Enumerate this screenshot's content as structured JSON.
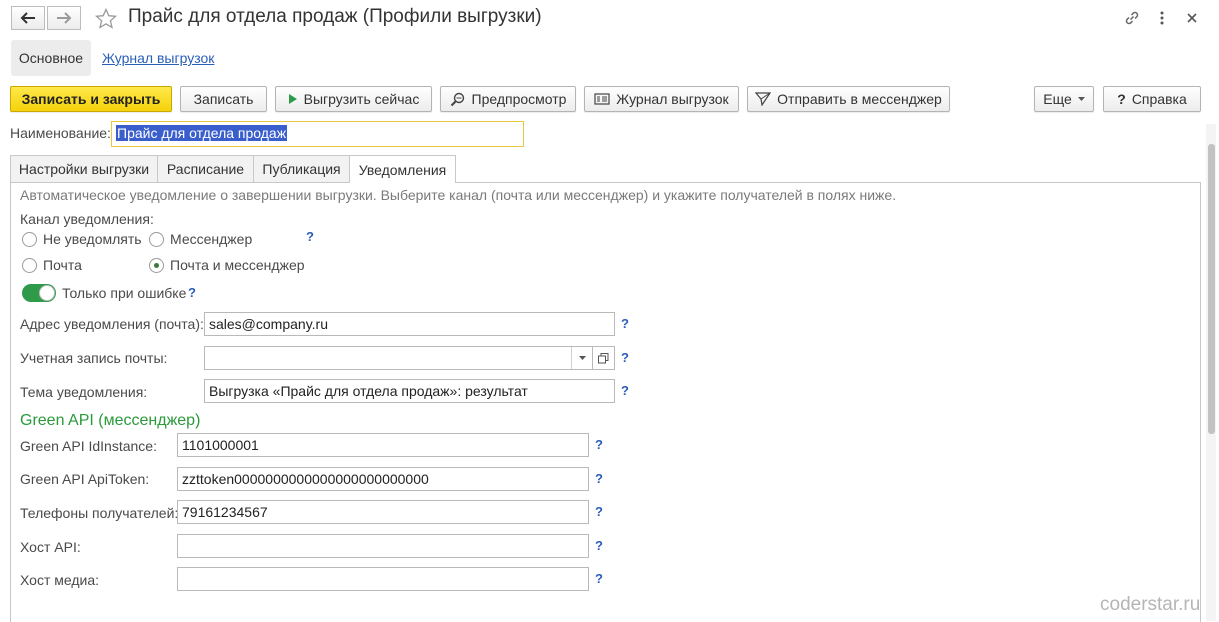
{
  "window": {
    "title": "Прайс для отдела продаж (Профили выгрузки)",
    "back_icon": "arrow-left-icon",
    "forward_icon": "arrow-right-icon",
    "favorite_icon": "star-icon",
    "link_icon": "link-icon",
    "more_icon": "more-vertical-icon",
    "close_icon": "close-icon"
  },
  "view_tabs": {
    "main": "Основное",
    "journal": "Журнал выгрузок"
  },
  "toolbar": {
    "save_close": "Записать и закрыть",
    "save": "Записать",
    "export_now": "Выгрузить сейчас",
    "preview": "Предпросмотр",
    "journal": "Журнал выгрузок",
    "send_messenger": "Отправить в мессенджер",
    "more": "Еще",
    "help": "Справка",
    "help_mark": "?"
  },
  "name": {
    "label": "Наименование:",
    "value": "Прайс для отдела продаж"
  },
  "tabs": [
    "Настройки выгрузки",
    "Расписание",
    "Публикация",
    "Уведомления"
  ],
  "notifications": {
    "description": "Автоматическое уведомление о завершении выгрузки. Выберите канал (почта или мессенджер) и укажите получателей в полях ниже.",
    "channel_label": "Канал уведомления:",
    "options": {
      "none": "Не уведомлять",
      "messenger": "Мессенджер",
      "mail": "Почта",
      "mail_messenger": "Почта и мессенджер"
    },
    "selected_option": "Почта и мессенджер",
    "only_on_error_label": "Только при ошибке",
    "only_on_error_enabled": true,
    "email_label": "Адрес уведомления (почта):",
    "email_value": "sales@company.ru",
    "account_label": "Учетная запись почты:",
    "account_value": "",
    "subject_label": "Тема уведомления:",
    "subject_value": "Выгрузка «Прайс для отдела продаж»: результат",
    "help_mark": "?"
  },
  "green_api": {
    "section_title": "Green API (мессенджер)",
    "id_label": "Green API IdInstance:",
    "id_value": "1101000001",
    "token_label": "Green API ApiToken:",
    "token_value": "zzttoken0000000000000000000000000",
    "phones_label": "Телефоны получателей:",
    "phones_value": "79161234567",
    "host_api_label": "Хост API:",
    "host_api_value": "",
    "host_media_label": "Хост медиа:",
    "host_media_value": ""
  },
  "watermark": "coderstar.ru",
  "colors": {
    "primary_button": "#f5d20a",
    "link": "#2a5eb8",
    "section_title": "#2a9a3a",
    "toggle_on": "#2f9b4a",
    "selection": "#3a5fcd"
  }
}
